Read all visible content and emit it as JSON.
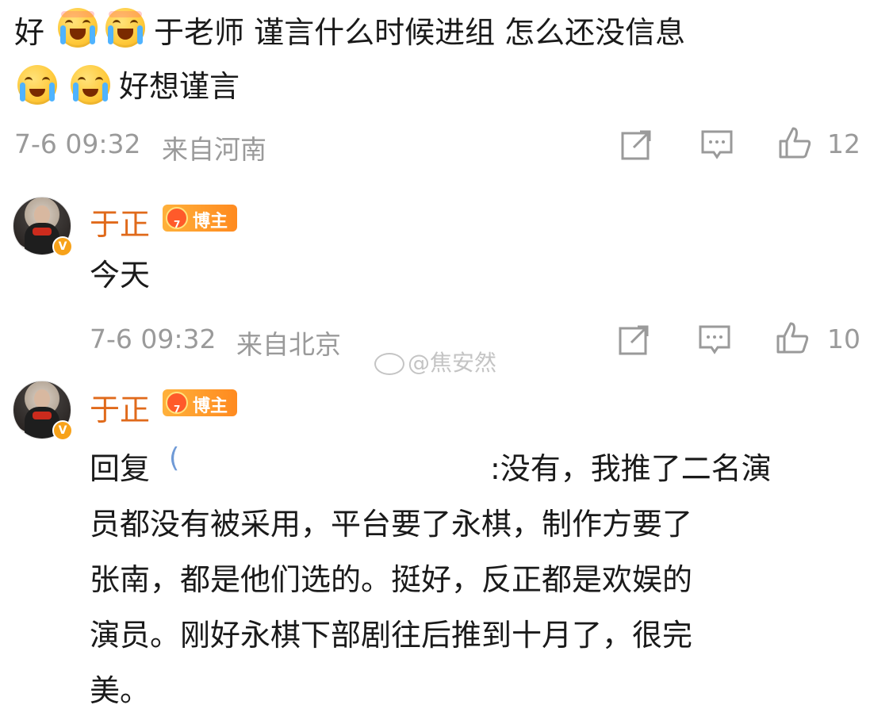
{
  "first_comment": {
    "line1_prefix": "好",
    "line1_rest": "于老师 谨言什么时候进组 怎么还没信息",
    "line2_rest": "好想谨言",
    "emoji_icons": [
      "laughing-crying-icon",
      "laughing-crying-icon",
      "crying-icon",
      "crying-icon"
    ],
    "timestamp": "7-6 09:32",
    "location": "来自河南",
    "like_count": "12"
  },
  "reply_one": {
    "username": "于正",
    "badge_label": "博主",
    "badge_level": "7",
    "verified_icon": "verified-v-icon",
    "text": "今天",
    "timestamp": "7-6 09:32",
    "location": "来自北京",
    "like_count": "10"
  },
  "reply_two": {
    "username": "于正",
    "badge_label": "博主",
    "badge_level": "7",
    "verified_icon": "verified-v-icon",
    "reply_prefix": "回复",
    "reply_line1_tail": ":没有，我推了二名演",
    "reply_line2": "员都没有被采用，平台要了永棋，制作方要了",
    "reply_line3": "张南，都是他们选的。挺好，反正都是欢娱的",
    "reply_line4": "演员。刚好永棋下部剧往后推到十月了，很完",
    "reply_line5": "美。"
  },
  "watermark": {
    "text": "@焦安然"
  },
  "colors": {
    "username": "#e06a1b",
    "meta_gray": "#9a9a9a",
    "badge_orange": "#ff8a1f"
  }
}
